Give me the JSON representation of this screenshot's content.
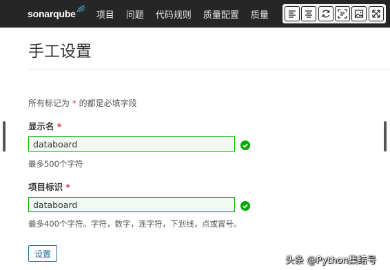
{
  "navbar": {
    "logo_text": "sonarqube",
    "items": [
      "项目",
      "问题",
      "代码规则",
      "质量配置",
      "质量"
    ]
  },
  "toolbar": {
    "icons": [
      "align-left-icon",
      "align-center-icon",
      "refresh-icon",
      "scan-text-icon",
      "image-icon",
      "expand-icon"
    ]
  },
  "page": {
    "title": "手工设置",
    "required_note_prefix": "所有标记为",
    "required_star": "*",
    "required_note_suffix": "的都是必填字段"
  },
  "fields": {
    "display_name": {
      "label": "显示名",
      "star": "*",
      "value": "databoard",
      "hint": "最多500个字符"
    },
    "project_key": {
      "label": "项目标识",
      "star": "*",
      "value": "databoard",
      "hint": "最多400个字符。字符，数字，连字符，下划线，点或冒号。"
    }
  },
  "submit_label": "设置",
  "watermark": "头条 @Python集结号",
  "colors": {
    "navbar_bg": "#262626",
    "valid_border": "#00aa00",
    "valid_icon": "#00aa00",
    "required_star": "#d4333f",
    "button_blue": "#236a97"
  }
}
